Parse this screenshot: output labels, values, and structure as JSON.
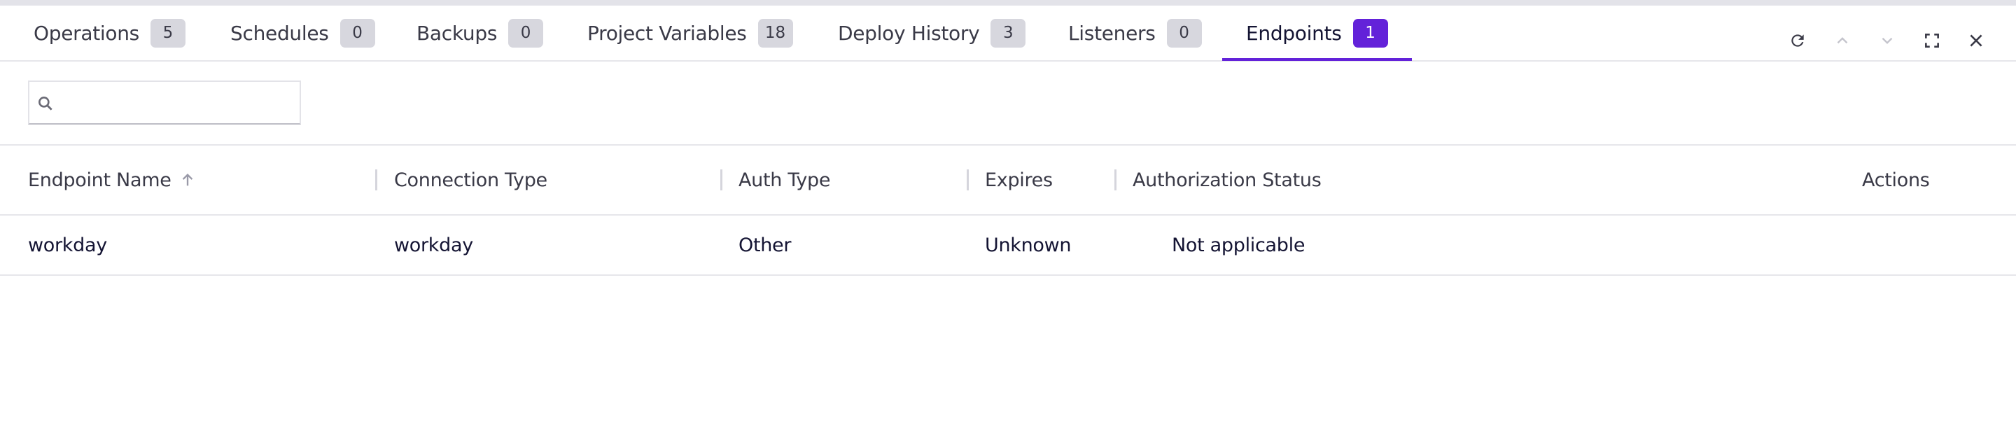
{
  "tabs": [
    {
      "label": "Operations",
      "count": "5",
      "active": false
    },
    {
      "label": "Schedules",
      "count": "0",
      "active": false
    },
    {
      "label": "Backups",
      "count": "0",
      "active": false
    },
    {
      "label": "Project Variables",
      "count": "18",
      "active": false
    },
    {
      "label": "Deploy History",
      "count": "3",
      "active": false
    },
    {
      "label": "Listeners",
      "count": "0",
      "active": false
    },
    {
      "label": "Endpoints",
      "count": "1",
      "active": true
    }
  ],
  "toolbar": {
    "icons": [
      "refresh-icon",
      "chevron-up-icon",
      "chevron-down-icon",
      "fullscreen-icon",
      "close-icon"
    ]
  },
  "search": {
    "value": "",
    "placeholder": ""
  },
  "table": {
    "columns": [
      {
        "label": "Endpoint Name",
        "sort": "ascending"
      },
      {
        "label": "Connection Type"
      },
      {
        "label": "Auth Type"
      },
      {
        "label": "Expires"
      },
      {
        "label": "Authorization Status"
      },
      {
        "label": "Actions"
      }
    ],
    "rows": [
      {
        "endpoint_name": "workday",
        "connection_type": "workday",
        "auth_type": "Other",
        "expires": "Unknown",
        "authorization_status": "Not applicable",
        "actions": ""
      }
    ]
  },
  "colors": {
    "accent": "#6322d9",
    "badge_bg": "#d7d7de",
    "text_primary": "#141433",
    "text_secondary": "#3a3a47",
    "divider": "#e6e6ea"
  }
}
